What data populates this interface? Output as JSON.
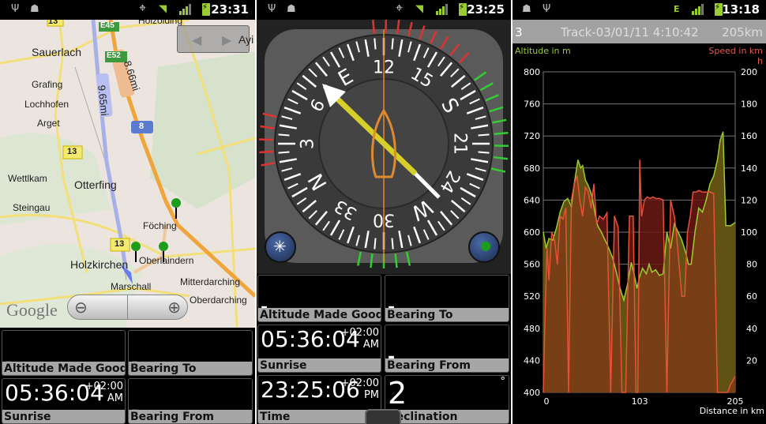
{
  "screens": [
    {
      "status": {
        "time": "23:31",
        "icons": [
          "usb-icon",
          "android-icon",
          "gps-icon",
          "wifi-icon",
          "signal-icon",
          "battery-charging-icon"
        ]
      },
      "map": {
        "places": [
          "Sauerlach",
          "Grafing",
          "Lochhofen",
          "Arget",
          "Wettlkam",
          "Otterfing",
          "Steingau",
          "Holzkirchen",
          "Föching",
          "Oberlaindern",
          "Marschall",
          "Mitterdarching",
          "Oberdarching",
          "Holzolding",
          "Ayi"
        ],
        "road_labels": [
          "13",
          "E45",
          "E52",
          "8",
          "13",
          "13"
        ],
        "route_labels": {
          "blue": "9.65mi",
          "orange": "8.66mi"
        },
        "logo": "Google",
        "zoom_out": "−",
        "zoom_in": "+"
      },
      "tiles": [
        {
          "value": "-",
          "label": "Altitude Made Good"
        },
        {
          "value": "-",
          "label": "Bearing To"
        },
        {
          "value": "05:36:04",
          "tz": "+02:00",
          "ampm": "AM",
          "label": "Sunrise"
        },
        {
          "value": "-",
          "label": "Bearing From"
        }
      ]
    },
    {
      "status": {
        "time": "23:25",
        "icons": [
          "usb-icon",
          "android-icon",
          "gps-icon",
          "wifi-icon",
          "signal-icon",
          "battery-charging-icon"
        ]
      },
      "compass": {
        "labels": [
          "N",
          "3",
          "6",
          "E",
          "12",
          "15",
          "S",
          "21",
          "24",
          "W",
          "30",
          "33"
        ],
        "heading_deg": 120
      },
      "tiles": [
        {
          "value": "-",
          "label": "Altitude Made Good"
        },
        {
          "value": "-",
          "label": "Bearing To"
        },
        {
          "value": "05:36:04",
          "tz": "+02:00",
          "ampm": "AM",
          "label": "Sunrise"
        },
        {
          "value": "-",
          "label": "Bearing From"
        },
        {
          "value": "23:25:06",
          "tz": "+02:00",
          "ampm": "PM",
          "label": "Time"
        },
        {
          "value": "2",
          "unit": "°",
          "label": "Declination"
        }
      ]
    },
    {
      "status": {
        "time": "13:18",
        "icons": [
          "android-icon",
          "usb-icon",
          "edge-data-icon",
          "signal-icon",
          "battery-charging-icon"
        ]
      },
      "track": {
        "number": "3",
        "name": "Track-03/01/11 4:10:42",
        "distance": "205km"
      },
      "colors": {
        "altitude": "#9acd32",
        "speed": "#e8503a"
      }
    }
  ],
  "chart_data": {
    "type": "area",
    "title": "Track-03/01/11 4:10:42",
    "xlabel": "Distance in km",
    "ylabel_left": "Altitude in m",
    "ylabel_right": "Speed in km/h",
    "x_ticks": [
      "0",
      "103",
      "205"
    ],
    "xlim": [
      0,
      205
    ],
    "ylim_left": [
      400,
      800
    ],
    "ylim_right": [
      0,
      200
    ],
    "y_ticks_left": [
      "800",
      "760",
      "720",
      "680",
      "640",
      "600",
      "560",
      "520",
      "480",
      "440",
      "400"
    ],
    "y_ticks_right": [
      "200",
      "180",
      "160",
      "140",
      "120",
      "100",
      "80",
      "60",
      "40",
      "20"
    ],
    "grid": true,
    "series": [
      {
        "name": "Altitude in m",
        "axis": "left",
        "x": [
          0,
          3,
          6,
          10,
          14,
          18,
          22,
          26,
          30,
          33,
          37,
          40,
          42,
          45,
          48,
          50,
          52,
          55,
          58,
          62,
          66,
          70,
          74,
          78,
          82,
          86,
          90,
          94,
          97,
          100,
          103,
          106,
          110,
          113,
          116,
          120,
          124,
          128,
          132,
          136,
          140,
          144,
          148,
          152,
          155,
          158,
          162,
          166,
          170,
          174,
          178,
          182,
          186,
          189,
          192,
          195,
          200,
          205
        ],
        "values": [
          600,
          580,
          592,
          590,
          605,
          625,
          638,
          642,
          632,
          660,
          690,
          680,
          683,
          665,
          658,
          652,
          645,
          625,
          608,
          600,
          590,
          580,
          568,
          550,
          530,
          515,
          535,
          562,
          548,
          530,
          545,
          555,
          548,
          560,
          550,
          553,
          546,
          548,
          600,
          580,
          610,
          600,
          590,
          575,
          560,
          560,
          600,
          630,
          625,
          640,
          660,
          670,
          690,
          715,
          725,
          608,
          608,
          612
        ]
      },
      {
        "name": "Speed in km/h",
        "axis": "right",
        "x": [
          0,
          2,
          4,
          6,
          9,
          12,
          15,
          18,
          21,
          24,
          27,
          30,
          33,
          36,
          39,
          42,
          45,
          48,
          51,
          54,
          57,
          60,
          64,
          68,
          72,
          76,
          80,
          84,
          88,
          92,
          96,
          99,
          101,
          103,
          105,
          108,
          111,
          114,
          117,
          120,
          124,
          128,
          132,
          136,
          140,
          142,
          145,
          148,
          151,
          154,
          157,
          160,
          163,
          166,
          170,
          174,
          178,
          182,
          186,
          190,
          194,
          197,
          200,
          205
        ],
        "values": [
          0,
          50,
          90,
          70,
          100,
          95,
          80,
          110,
          108,
          115,
          0,
          120,
          130,
          135,
          120,
          110,
          128,
          125,
          115,
          130,
          105,
          110,
          108,
          112,
          0,
          110,
          103,
          0,
          0,
          110,
          110,
          0,
          0,
          145,
          110,
          120,
          122,
          121,
          122,
          121,
          121,
          120,
          0,
          120,
          110,
          100,
          80,
          60,
          60,
          100,
          110,
          125,
          125,
          126,
          125,
          125,
          125,
          124,
          0,
          0,
          0,
          0,
          5,
          10
        ]
      }
    ]
  }
}
